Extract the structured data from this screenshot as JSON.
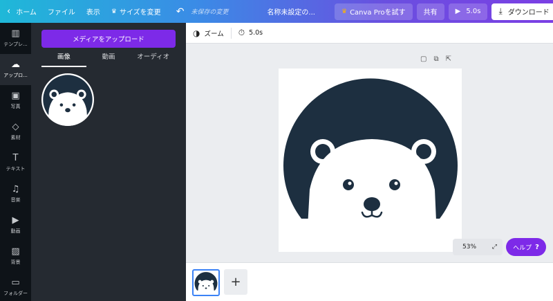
{
  "topbar": {
    "home": "ホーム",
    "file": "ファイル",
    "view": "表示",
    "resize": "サイズを変更",
    "unsaved": "未保存の変更",
    "title": "名称未設定の...",
    "pro": "Canva Proを試す",
    "share": "共有",
    "play": "5.0s",
    "download": "ダウンロード",
    "more": "···"
  },
  "rail": {
    "items": [
      {
        "label": "テンプレ...",
        "icon": "template-icon"
      },
      {
        "label": "アップロ...",
        "icon": "upload-cloud-icon"
      },
      {
        "label": "写真",
        "icon": "photo-icon"
      },
      {
        "label": "素材",
        "icon": "elements-icon"
      },
      {
        "label": "テキスト",
        "icon": "text-icon"
      },
      {
        "label": "音楽",
        "icon": "music-icon"
      },
      {
        "label": "動画",
        "icon": "video-icon"
      },
      {
        "label": "背景",
        "icon": "background-icon"
      },
      {
        "label": "フォルダー",
        "icon": "folder-icon"
      }
    ]
  },
  "panel": {
    "upload_button": "メディアをアップロード",
    "tabs": [
      "画像",
      "動画",
      "オーディオ"
    ]
  },
  "editor_toolbar": {
    "zoom": "ズーム",
    "duration": "5.0s"
  },
  "footer": {
    "zoom_level": "53%",
    "help": "ヘルプ",
    "help_icon": "?",
    "add_page": "+"
  },
  "colors": {
    "bear_bg": "#1d2f40",
    "accent_purple": "#7d2ae8",
    "rail_bg": "#0e1318",
    "panel_bg": "#252a31"
  }
}
